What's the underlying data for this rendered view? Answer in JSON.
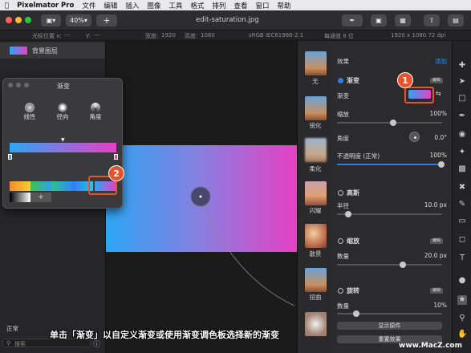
{
  "menubar": {
    "apple": "",
    "app": "Pixelmator Pro",
    "items": [
      "文件",
      "编辑",
      "插入",
      "图像",
      "工具",
      "格式",
      "排列",
      "查看",
      "窗口",
      "帮助"
    ]
  },
  "toolbar": {
    "zoom": "40%",
    "add": "+",
    "doc_title": "edit-saturation.jpg"
  },
  "infobar": {
    "pos_label": "光标位置 x:",
    "pos_x": "---",
    "pos_y_label": "y:",
    "pos_y": "---",
    "width_label": "宽度:",
    "width": "1920",
    "height_label": "高度:",
    "height": "1080",
    "profile": "sRGB IEC61966-2.1",
    "depth": "每通道 8 位",
    "size": "1920 x 1080 72 dpi"
  },
  "layers": {
    "layer_name": "背景图层",
    "blend": "正常",
    "search_placeholder": "搜索"
  },
  "strip": {
    "labels": [
      "无",
      "锐化",
      "柔化",
      "闪耀",
      "散景",
      "扭曲"
    ]
  },
  "effects": {
    "header": "效果",
    "add": "添加",
    "gradient": {
      "title": "渐变",
      "edit": "编辑",
      "grad_label": "渐变",
      "scale_label": "缩放",
      "scale": "100%",
      "angle_label": "角度",
      "angle": "0.0°",
      "opacity_label": "不透明度 (正常)",
      "opacity": "100%"
    },
    "gauss": {
      "title": "高斯",
      "radius_label": "半径",
      "radius": "10.0 px"
    },
    "zoom": {
      "title": "缩放",
      "edit": "编辑",
      "amount_label": "数量",
      "amount": "20.0 px"
    },
    "spin": {
      "title": "旋转",
      "edit": "编辑",
      "amount_label": "数量",
      "amount": "10%"
    },
    "btn_show": "显示原件",
    "btn_reset": "重置效果"
  },
  "popup": {
    "title": "渐变",
    "types": [
      "线性",
      "径向",
      "角度"
    ],
    "add": "+"
  },
  "badges": [
    "1",
    "2"
  ],
  "caption": "单击「渐变」以自定义渐变或使用渐变调色板选择新的渐变",
  "watermark": "www.MacZ.com",
  "colors": {
    "grad_start": "#2ea6f5",
    "grad_end": "#e640c4",
    "accent": "#2a7ff0",
    "badge": "#e8532c"
  }
}
